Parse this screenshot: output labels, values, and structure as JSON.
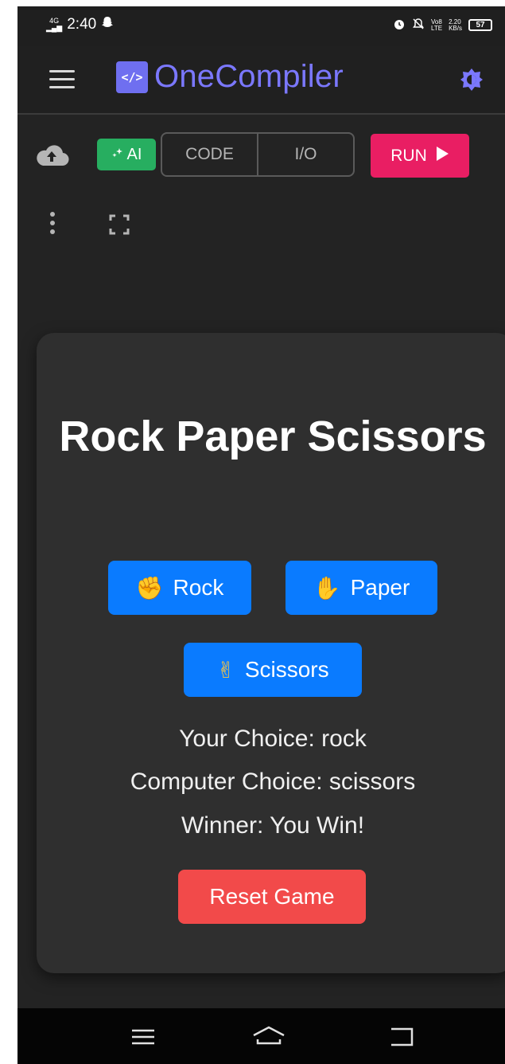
{
  "status_bar": {
    "network": "4G",
    "time": "2:40",
    "battery": "57",
    "speed_value": "2.20",
    "speed_unit": "KB/s",
    "volte": "Vo8",
    "lte": "LTE",
    "icons": [
      "snapchat-icon",
      "alarm-icon",
      "mute-icon"
    ]
  },
  "header": {
    "logo_text": "</>",
    "app_name": "OneCompiler",
    "icons": {
      "menu": "hamburger-icon",
      "theme": "theme-toggle-icon"
    }
  },
  "toolbar": {
    "ai_label": "AI",
    "tabs": [
      {
        "label": "CODE"
      },
      {
        "label": "I/O"
      }
    ],
    "run_label": "RUN"
  },
  "game": {
    "title": "Rock Paper Scissors",
    "buttons": {
      "rock": {
        "emoji": "✊",
        "label": "Rock"
      },
      "paper": {
        "emoji": "✋",
        "label": "Paper"
      },
      "scissors": {
        "emoji": "✌",
        "label": "Scissors"
      }
    },
    "your_choice": "Your Choice: rock",
    "computer_choice": "Computer Choice: scissors",
    "winner": "Winner: You Win!",
    "reset_label": "Reset Game"
  },
  "colors": {
    "accent": "#7b78ff",
    "run": "#e91e63",
    "ai": "#27ae60",
    "choice_button": "#0a7bff",
    "reset_button": "#f24a4a"
  }
}
